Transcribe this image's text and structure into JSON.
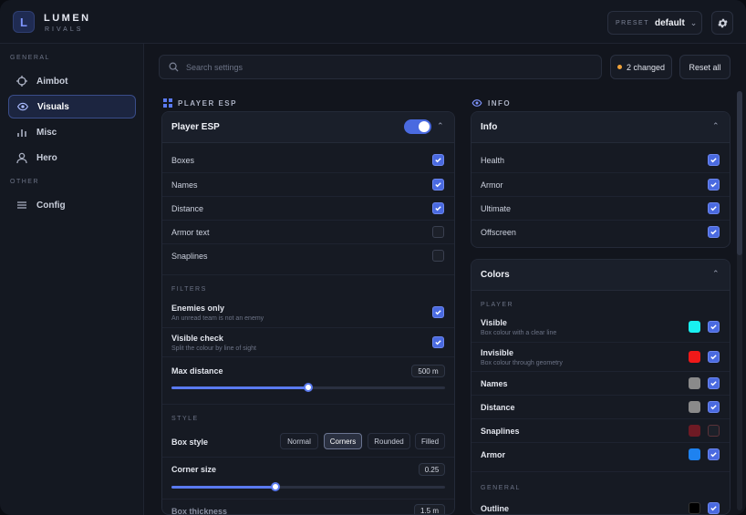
{
  "brand": {
    "name": "LUMEN",
    "sub": "RIVALS"
  },
  "header": {
    "preset_label": "PRESET",
    "preset_value": "default"
  },
  "sidebar": {
    "sections": [
      "GENERAL",
      "OTHER"
    ],
    "items": [
      {
        "label": "Aimbot",
        "icon": "crosshair-icon"
      },
      {
        "label": "Visuals",
        "icon": "eye-icon",
        "active": true
      },
      {
        "label": "Misc",
        "icon": "bar-chart-icon"
      },
      {
        "label": "Hero",
        "icon": "user-icon"
      },
      {
        "label": "Config",
        "icon": "menu-icon"
      }
    ]
  },
  "toolbar": {
    "search_placeholder": "Search settings",
    "changed": "2 changed",
    "reset": "Reset all"
  },
  "player_esp": {
    "section": "PLAYER ESP",
    "title": "Player ESP",
    "enabled": true,
    "options": [
      {
        "label": "Boxes",
        "checked": true
      },
      {
        "label": "Names",
        "checked": true
      },
      {
        "label": "Distance",
        "checked": true
      },
      {
        "label": "Armor text",
        "checked": false
      },
      {
        "label": "Snaplines",
        "checked": false
      }
    ],
    "filters_label": "FILTERS",
    "filters": [
      {
        "label": "Enemies only",
        "desc": "An unread team is not an enemy",
        "checked": true
      },
      {
        "label": "Visible check",
        "desc": "Split the colour by line of sight",
        "checked": true
      }
    ],
    "max_distance": {
      "label": "Max distance",
      "value": "500 m",
      "fraction": 0.5
    },
    "style_label": "STYLE",
    "box_style": {
      "label": "Box style",
      "options": [
        "Normal",
        "Corners",
        "Rounded",
        "Filled"
      ],
      "selected": "Corners"
    },
    "corner_size": {
      "label": "Corner size",
      "value": "0.25",
      "fraction": 0.38
    },
    "box_thickness": {
      "label": "Box thickness",
      "value": "1.5 m"
    }
  },
  "info": {
    "section": "INFO",
    "title": "Info",
    "options": [
      {
        "label": "Health",
        "checked": true
      },
      {
        "label": "Armor",
        "checked": true
      },
      {
        "label": "Ultimate",
        "checked": true
      },
      {
        "label": "Offscreen",
        "checked": true
      }
    ]
  },
  "colors": {
    "title": "Colors",
    "player_label": "PLAYER",
    "player": [
      {
        "label": "Visible",
        "desc": "Box colour with a clear line",
        "color": "#19f0f0",
        "checked": true
      },
      {
        "label": "Invisible",
        "desc": "Box colour through geometry",
        "color": "#f01919",
        "checked": true
      },
      {
        "label": "Names",
        "desc": "",
        "color": "#8a8a8a",
        "checked": true
      },
      {
        "label": "Distance",
        "desc": "",
        "color": "#8a8a8a",
        "checked": true
      },
      {
        "label": "Snaplines",
        "desc": "",
        "color": "#6e1a24",
        "checked": false
      },
      {
        "label": "Armor",
        "desc": "",
        "color": "#1e82f0",
        "checked": true
      }
    ],
    "general_label": "GENERAL",
    "general": [
      {
        "label": "Outline",
        "color": "#000000",
        "checked": true
      }
    ]
  },
  "accent": "#4a6ae0"
}
